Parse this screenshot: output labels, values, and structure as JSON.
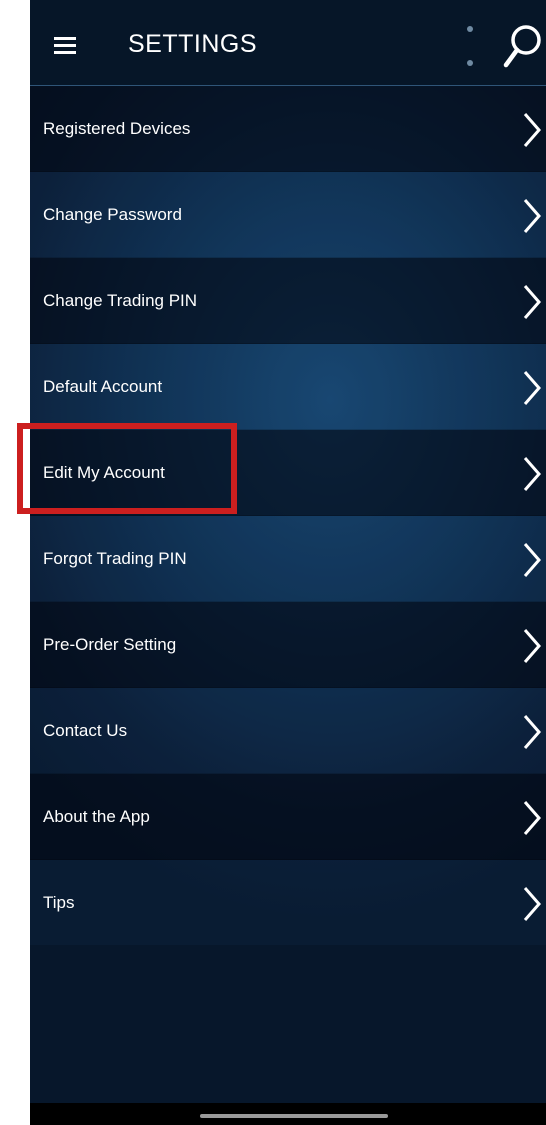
{
  "header": {
    "title": "SETTINGS",
    "menu_icon": "hamburger-menu-icon",
    "overflow_icon": "vertical-dots-icon",
    "search_icon": "search-icon"
  },
  "menu": {
    "items": [
      {
        "label": "Registered Devices"
      },
      {
        "label": "Change Password"
      },
      {
        "label": "Change Trading PIN"
      },
      {
        "label": "Default Account"
      },
      {
        "label": "Edit My Account"
      },
      {
        "label": "Forgot Trading PIN"
      },
      {
        "label": "Pre-Order Setting"
      },
      {
        "label": "Contact Us"
      },
      {
        "label": "About the App"
      },
      {
        "label": "Tips"
      }
    ]
  },
  "annotation": {
    "highlighted_item": "Edit My Account",
    "color": "#cc1f1f"
  },
  "colors": {
    "header_bg": "#061628",
    "text": "#ffffff",
    "accent": "#17466f"
  }
}
